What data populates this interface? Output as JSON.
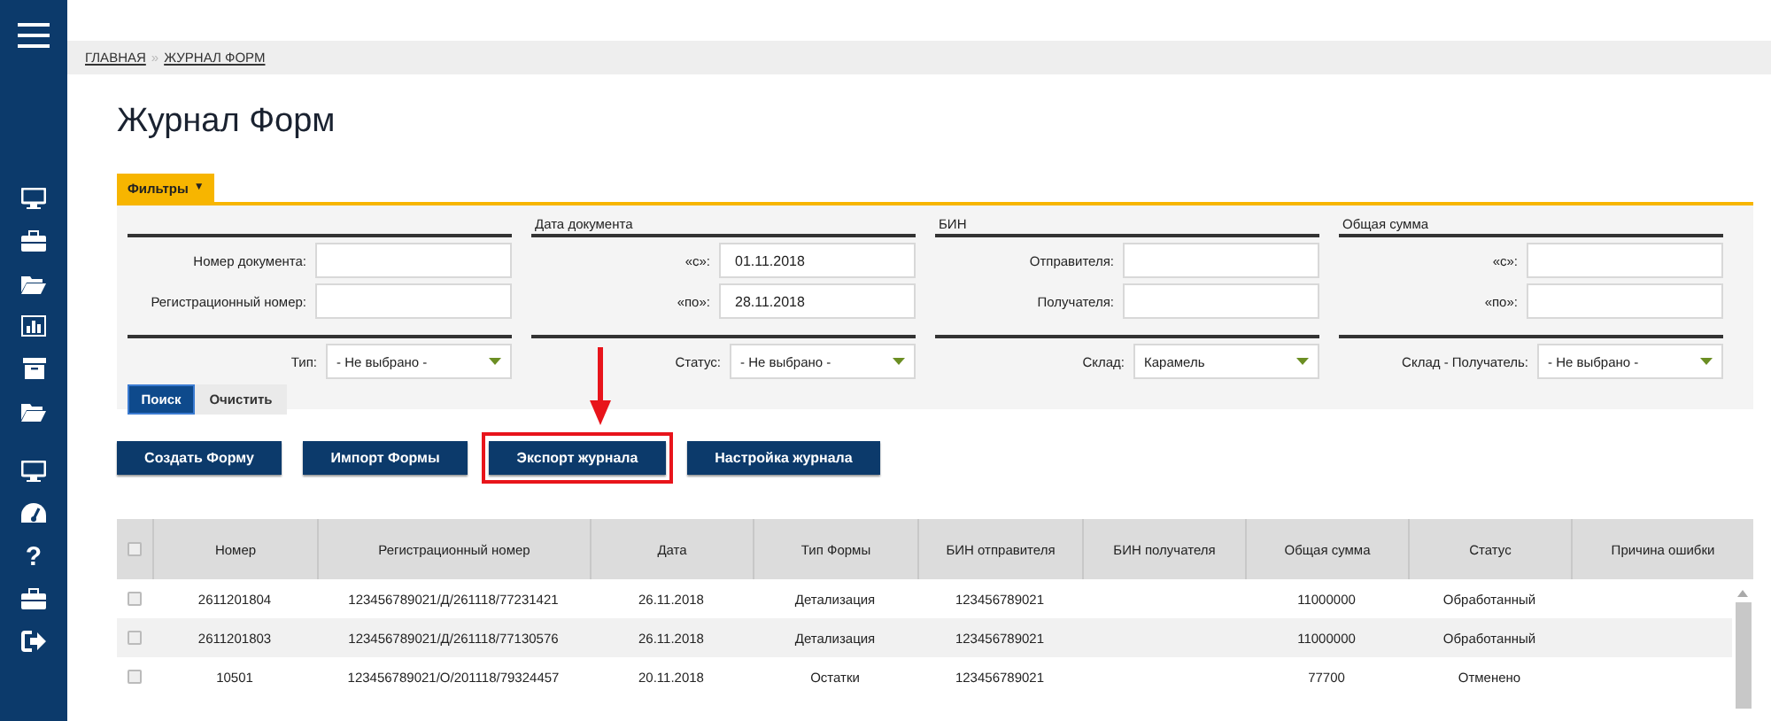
{
  "sidebar": {
    "help_glyph": "?"
  },
  "breadcrumb": {
    "separator": "»",
    "items": [
      "ГЛАВНАЯ",
      "ЖУРНАЛ ФОРМ"
    ]
  },
  "page_title": "Журнал Форм",
  "filters": {
    "tab_label": "Фильтры",
    "tab_caret": "▼",
    "groups": [
      {
        "fields": [
          {
            "label": "Номер документа:"
          },
          {
            "label": "Регистрационный номер:"
          }
        ],
        "select": {
          "label": "Тип:",
          "value": "- Не выбрано -"
        }
      },
      {
        "heading": "Дата документа",
        "fields": [
          {
            "label": "«с»:",
            "value": "01.11.2018"
          },
          {
            "label": "«по»:",
            "value": "28.11.2018"
          }
        ],
        "select": {
          "label": "Статус:",
          "value": "- Не выбрано -"
        }
      },
      {
        "heading": "БИН",
        "fields": [
          {
            "label": "Отправителя:"
          },
          {
            "label": "Получателя:"
          }
        ],
        "select": {
          "label": "Склад:",
          "value": "Карамель"
        }
      },
      {
        "heading": "Общая сумма",
        "fields": [
          {
            "label": "«с»:"
          },
          {
            "label": "«по»:"
          }
        ],
        "select": {
          "label": "Склад - Получатель:",
          "value": "- Не выбрано -"
        }
      }
    ],
    "search_button": "Поиск",
    "clear_button": "Очистить"
  },
  "actions": [
    {
      "label": "Создать Форму",
      "highlighted": false
    },
    {
      "label": "Импорт Формы",
      "highlighted": false
    },
    {
      "label": "Экспорт журнала",
      "highlighted": true
    },
    {
      "label": "Настройка журнала",
      "highlighted": false
    }
  ],
  "table": {
    "select_all_checked": false,
    "columns": [
      "Номер",
      "Регистрационный номер",
      "Дата",
      "Тип Формы",
      "БИН отправителя",
      "БИН получателя",
      "Общая сумма",
      "Статус",
      "Причина ошибки"
    ],
    "rows": [
      {
        "checked": false,
        "cells": [
          "2611201804",
          "123456789021/Д/261118/77231421",
          "26.11.2018",
          "Детализация",
          "123456789021",
          "",
          "11000000",
          "Обработанный",
          ""
        ]
      },
      {
        "checked": false,
        "cells": [
          "2611201803",
          "123456789021/Д/261118/77130576",
          "26.11.2018",
          "Детализация",
          "123456789021",
          "",
          "11000000",
          "Обработанный",
          ""
        ]
      },
      {
        "checked": false,
        "cells": [
          "10501",
          "123456789021/О/201118/79324457",
          "20.11.2018",
          "Остатки",
          "123456789021",
          "",
          "77700",
          "Отменено",
          ""
        ]
      }
    ]
  }
}
